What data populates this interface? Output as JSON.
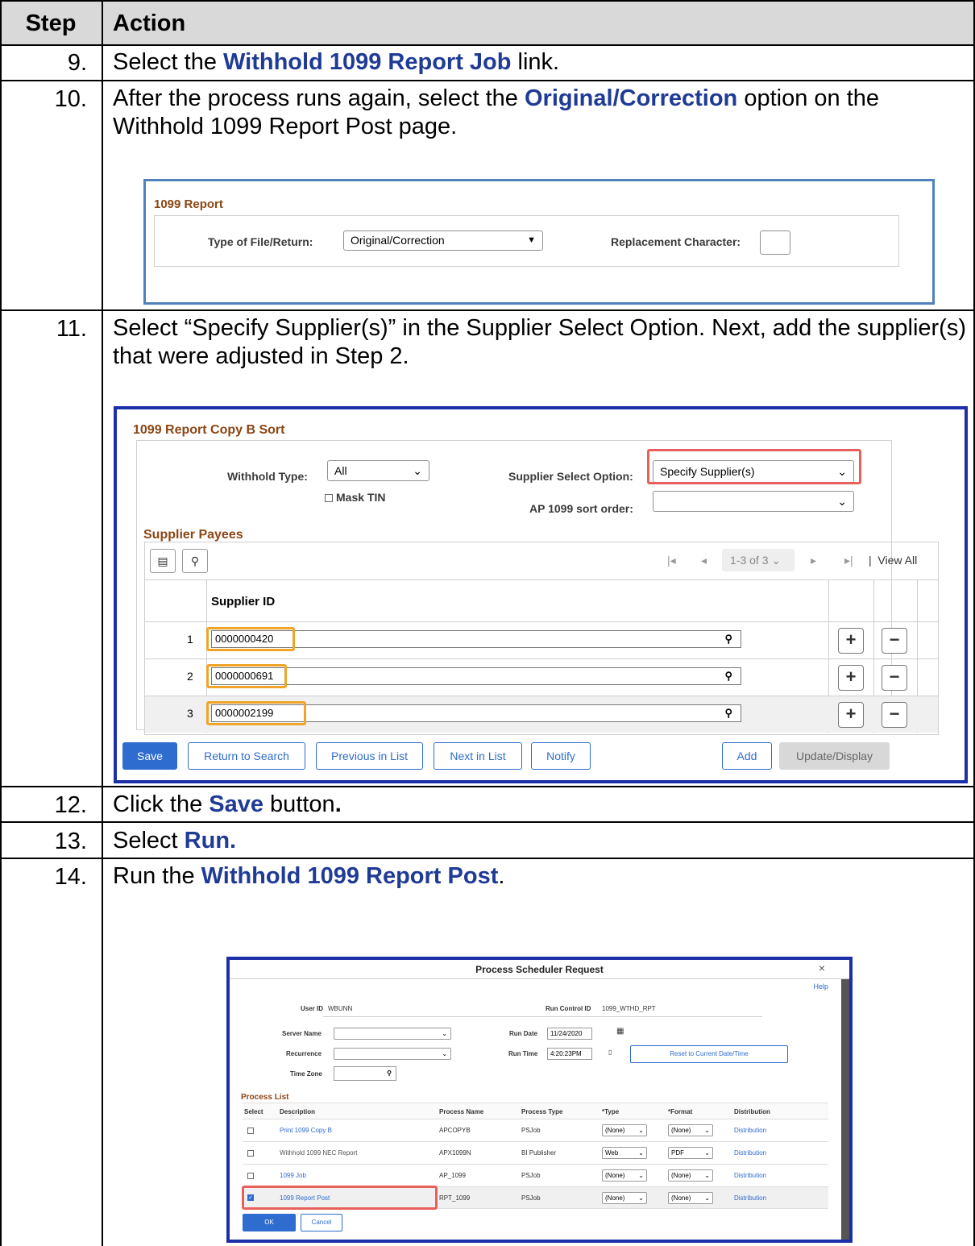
{
  "header": {
    "step": "Step",
    "action": "Action"
  },
  "steps": [
    {
      "num": "9.",
      "pre": "Select the ",
      "hl": "Withhold 1099 Report Job",
      "post": " link."
    },
    {
      "num": "10.",
      "pre": "After the process runs again, select the ",
      "hl": "Original/Correction",
      "post": " option on the Withhold 1099 Report Post page."
    },
    {
      "num": "11.",
      "text": "Select “Specify Supplier(s)” in the Supplier Select Option. Next, add the supplier(s) that were adjusted in Step 2."
    },
    {
      "num": "12.",
      "pre": "Click the ",
      "hl": "Save",
      "post": " button",
      "post_bold": "."
    },
    {
      "num": "13.",
      "pre": "Select ",
      "hl": "Run."
    },
    {
      "num": "14.",
      "pre": "Run the ",
      "hl": "Withhold 1099 Report Post",
      "post": "."
    }
  ],
  "report_panel": {
    "title": "1099 Report",
    "type_label": "Type of File/Return:",
    "type_value": "Original/Correction",
    "replacement_label": "Replacement Character:",
    "replacement_value": ""
  },
  "copyb_panel": {
    "title": "1099 Report Copy B Sort",
    "withhold_type_label": "Withhold Type:",
    "withhold_type_value": "All",
    "mask_tin_label": "Mask TIN",
    "supplier_select_label": "Supplier Select Option:",
    "supplier_select_value": "Specify Supplier(s)",
    "sort_order_label": "AP 1099 sort order:",
    "sort_order_value": "",
    "grid_title": "Supplier Payees",
    "pager_text": "1-3 of 3",
    "view_all": "View All",
    "col_header": "Supplier ID",
    "rows": [
      {
        "num": "1",
        "id": "0000000420"
      },
      {
        "num": "2",
        "id": "0000000691"
      },
      {
        "num": "3",
        "id": "0000002199"
      }
    ],
    "buttons": {
      "save": "Save",
      "return": "Return to Search",
      "previous": "Previous in List",
      "next": "Next in List",
      "notify": "Notify",
      "add": "Add",
      "update": "Update/Display"
    }
  },
  "scheduler": {
    "title": "Process Scheduler Request",
    "close": "×",
    "help": "Help",
    "user_id_label": "User ID",
    "user_id": "WBUNN",
    "run_control_label": "Run Control ID",
    "run_control": "1099_WTHD_RPT",
    "server_label": "Server Name",
    "server_value": "",
    "run_date_label": "Run Date",
    "run_date": "11/24/2020",
    "recurrence_label": "Recurrence",
    "recurrence_value": "",
    "run_time_label": "Run Time",
    "run_time": "4:20:23PM",
    "reset_button": "Reset to Current Date/Time",
    "timezone_label": "Time Zone",
    "timezone_value": "",
    "process_list_title": "Process List",
    "columns": [
      "Select",
      "Description",
      "Process Name",
      "Process Type",
      "*Type",
      "*Format",
      "Distribution"
    ],
    "processes": [
      {
        "desc": "Print 1099 Copy B",
        "name": "APCOPYB",
        "ptype": "PSJob",
        "type": "(None)",
        "format": "(None)",
        "dist": "Distribution",
        "checked": false
      },
      {
        "desc": "Withhold 1099 NEC Report",
        "name": "APX1099N",
        "ptype": "BI Publisher",
        "type": "Web",
        "format": "PDF",
        "dist": "Distribution",
        "checked": false
      },
      {
        "desc": "1099 Job",
        "name": "AP_1099",
        "ptype": "PSJob",
        "type": "(None)",
        "format": "(None)",
        "dist": "Distribution",
        "checked": false
      },
      {
        "desc": "1099 Report Post",
        "name": "RPT_1099",
        "ptype": "PSJob",
        "type": "(None)",
        "format": "(None)",
        "dist": "Distribution",
        "checked": true
      }
    ],
    "ok": "OK",
    "cancel": "Cancel"
  }
}
